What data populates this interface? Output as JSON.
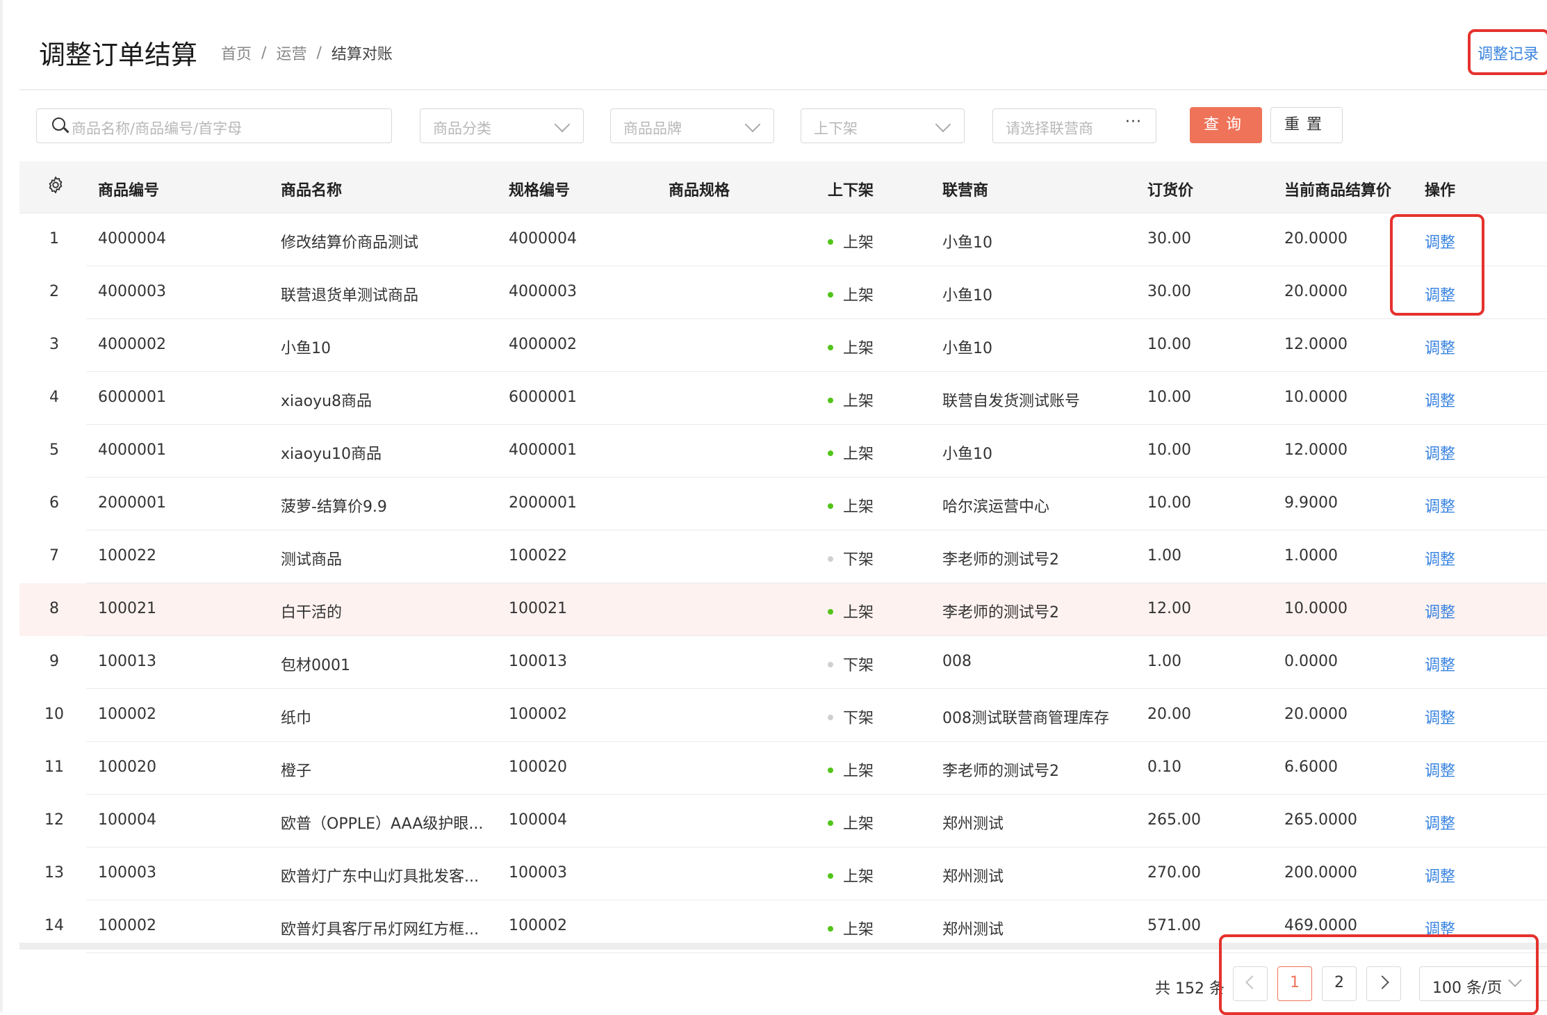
{
  "header": {
    "title": "调整订单结算",
    "breadcrumb": [
      "首页",
      "运营",
      "结算对账"
    ],
    "separator": "/",
    "record_link": "调整记录"
  },
  "filters": {
    "search_placeholder": "商品名称/商品编号/首字母",
    "category_placeholder": "商品分类",
    "brand_placeholder": "商品品牌",
    "shelf_placeholder": "上下架",
    "partner_placeholder": "请选择联营商",
    "partner_more": "···",
    "query_label": "查询",
    "reset_label": "重置"
  },
  "table": {
    "columns": [
      "商品编号",
      "商品名称",
      "规格编号",
      "商品规格",
      "上下架",
      "联营商",
      "订货价",
      "当前商品结算价",
      "操作"
    ],
    "status_colors": {
      "上架": "#52c41a",
      "下架": "#d0d0d0"
    },
    "rows": [
      {
        "idx": "1",
        "code": "4000004",
        "name": "修改结算价商品测试",
        "spec_code": "4000004",
        "spec": "",
        "status": "上架",
        "partner": "小鱼10",
        "order_price": "30.00",
        "settle_price": "20.0000",
        "action": "调整"
      },
      {
        "idx": "2",
        "code": "4000003",
        "name": "联营退货单测试商品",
        "spec_code": "4000003",
        "spec": "",
        "status": "上架",
        "partner": "小鱼10",
        "order_price": "30.00",
        "settle_price": "20.0000",
        "action": "调整"
      },
      {
        "idx": "3",
        "code": "4000002",
        "name": "小鱼10",
        "spec_code": "4000002",
        "spec": "",
        "status": "上架",
        "partner": "小鱼10",
        "order_price": "10.00",
        "settle_price": "12.0000",
        "action": "调整"
      },
      {
        "idx": "4",
        "code": "6000001",
        "name": "xiaoyu8商品",
        "spec_code": "6000001",
        "spec": "",
        "status": "上架",
        "partner": "联营自发货测试账号",
        "order_price": "10.00",
        "settle_price": "10.0000",
        "action": "调整"
      },
      {
        "idx": "5",
        "code": "4000001",
        "name": "xiaoyu10商品",
        "spec_code": "4000001",
        "spec": "",
        "status": "上架",
        "partner": "小鱼10",
        "order_price": "10.00",
        "settle_price": "12.0000",
        "action": "调整"
      },
      {
        "idx": "6",
        "code": "2000001",
        "name": "菠萝-结算价9.9",
        "spec_code": "2000001",
        "spec": "",
        "status": "上架",
        "partner": "哈尔滨运营中心",
        "order_price": "10.00",
        "settle_price": "9.9000",
        "action": "调整"
      },
      {
        "idx": "7",
        "code": "100022",
        "name": "测试商品",
        "spec_code": "100022",
        "spec": "",
        "status": "下架",
        "partner": "李老师的测试号2",
        "order_price": "1.00",
        "settle_price": "1.0000",
        "action": "调整"
      },
      {
        "idx": "8",
        "code": "100021",
        "name": "白干活的",
        "spec_code": "100021",
        "spec": "",
        "status": "上架",
        "partner": "李老师的测试号2",
        "order_price": "12.00",
        "settle_price": "10.0000",
        "action": "调整"
      },
      {
        "idx": "9",
        "code": "100013",
        "name": "包材0001",
        "spec_code": "100013",
        "spec": "",
        "status": "下架",
        "partner": "008",
        "order_price": "1.00",
        "settle_price": "0.0000",
        "action": "调整"
      },
      {
        "idx": "10",
        "code": "100002",
        "name": "纸巾",
        "spec_code": "100002",
        "spec": "",
        "status": "下架",
        "partner": "008测试联营商管理库存",
        "order_price": "20.00",
        "settle_price": "20.0000",
        "action": "调整"
      },
      {
        "idx": "11",
        "code": "100020",
        "name": "橙子",
        "spec_code": "100020",
        "spec": "",
        "status": "上架",
        "partner": "李老师的测试号2",
        "order_price": "0.10",
        "settle_price": "6.6000",
        "action": "调整"
      },
      {
        "idx": "12",
        "code": "100004",
        "name": "欧普（OPPLE）AAA级护眼...",
        "spec_code": "100004",
        "spec": "",
        "status": "上架",
        "partner": "郑州测试",
        "order_price": "265.00",
        "settle_price": "265.0000",
        "action": "调整"
      },
      {
        "idx": "13",
        "code": "100003",
        "name": "欧普灯广东中山灯具批发客...",
        "spec_code": "100003",
        "spec": "",
        "status": "上架",
        "partner": "郑州测试",
        "order_price": "270.00",
        "settle_price": "200.0000",
        "action": "调整"
      },
      {
        "idx": "14",
        "code": "100002",
        "name": "欧普灯具客厅吊灯网红方框...",
        "spec_code": "100002",
        "spec": "",
        "status": "上架",
        "partner": "郑州测试",
        "order_price": "571.00",
        "settle_price": "469.0000",
        "action": "调整"
      }
    ]
  },
  "pagination": {
    "total_text": "共 152 条",
    "pages": [
      "1",
      "2"
    ],
    "current_page": "1",
    "page_size": "100 条/页"
  },
  "colors": {
    "accent": "#ef7359",
    "link": "#3a84e0",
    "annotation": "#e5322d",
    "highlight_row": "#fdf2f0"
  }
}
